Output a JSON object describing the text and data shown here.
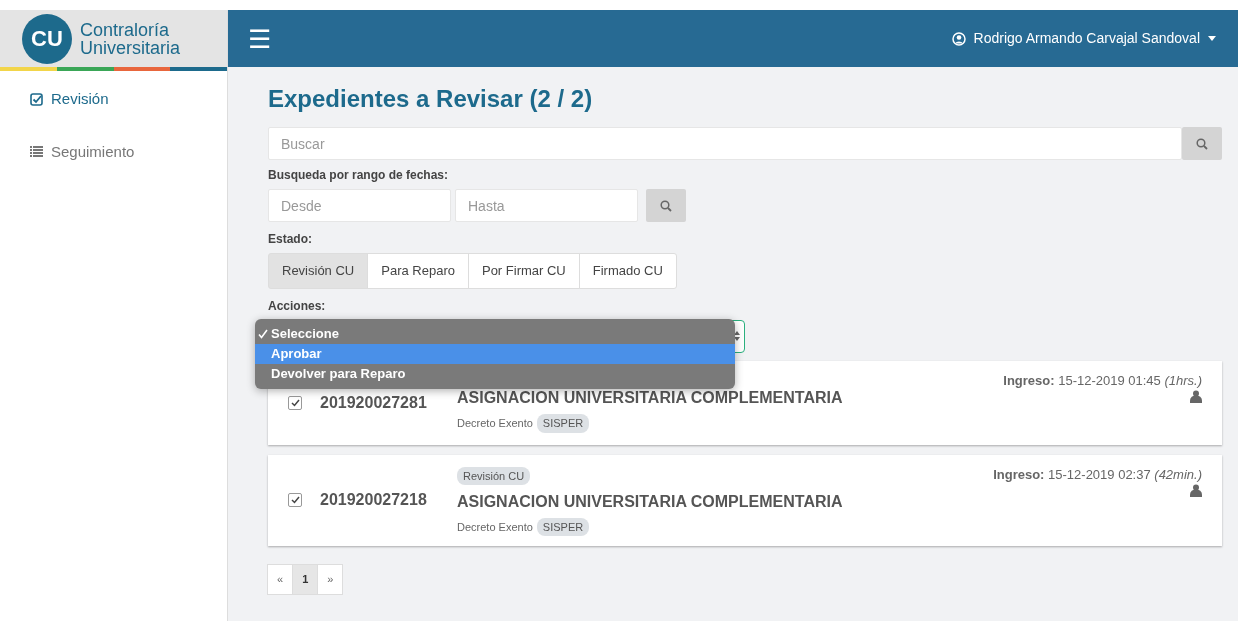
{
  "logo": {
    "initials": "CU",
    "line1": "Contraloría",
    "line2": "Universitaria"
  },
  "sidebar": {
    "items": [
      {
        "label": "Revisión",
        "selected": true
      },
      {
        "label": "Seguimiento",
        "selected": false
      }
    ]
  },
  "header": {
    "menu_icon": "☰",
    "user": "Rodrigo Armando Carvajal Sandoval"
  },
  "title": "Expedientes a Revisar (2 / 2)",
  "search": {
    "placeholder": "Buscar"
  },
  "date_range": {
    "label": "Busqueda por rango de fechas:",
    "from_placeholder": "Desde",
    "to_placeholder": "Hasta"
  },
  "estado": {
    "label": "Estado:",
    "options": [
      {
        "label": "Revisión CU",
        "selected": true
      },
      {
        "label": "Para Reparo",
        "selected": false
      },
      {
        "label": "Por Firmar CU",
        "selected": false
      },
      {
        "label": "Firmado CU",
        "selected": false
      }
    ]
  },
  "acciones": {
    "label": "Acciones:",
    "dropdown": [
      {
        "label": "Seleccione",
        "checked": true,
        "highlighted": false
      },
      {
        "label": "Aprobar",
        "checked": false,
        "highlighted": true
      },
      {
        "label": "Devolver para Reparo",
        "checked": false,
        "highlighted": false
      }
    ]
  },
  "expedientes": [
    {
      "checked": true,
      "number": "201920027281",
      "title": "ASIGNACION UNIVERSITARIA COMPLEMENTARIA",
      "type": "Decreto Exento",
      "tag": "SISPER",
      "ingreso_label": "Ingreso:",
      "ingreso": "15-12-2019 01:45",
      "elapsed": "(1hrs.)"
    },
    {
      "checked": true,
      "status": "Revisión CU",
      "number": "201920027218",
      "title": "ASIGNACION UNIVERSITARIA COMPLEMENTARIA",
      "type": "Decreto Exento",
      "tag": "SISPER",
      "ingreso_label": "Ingreso:",
      "ingreso": "15-12-2019 02:37",
      "elapsed": "(42min.)"
    }
  ],
  "pagination": [
    {
      "label": "«",
      "selected": false
    },
    {
      "label": "1",
      "selected": true
    },
    {
      "label": "»",
      "selected": false
    }
  ]
}
